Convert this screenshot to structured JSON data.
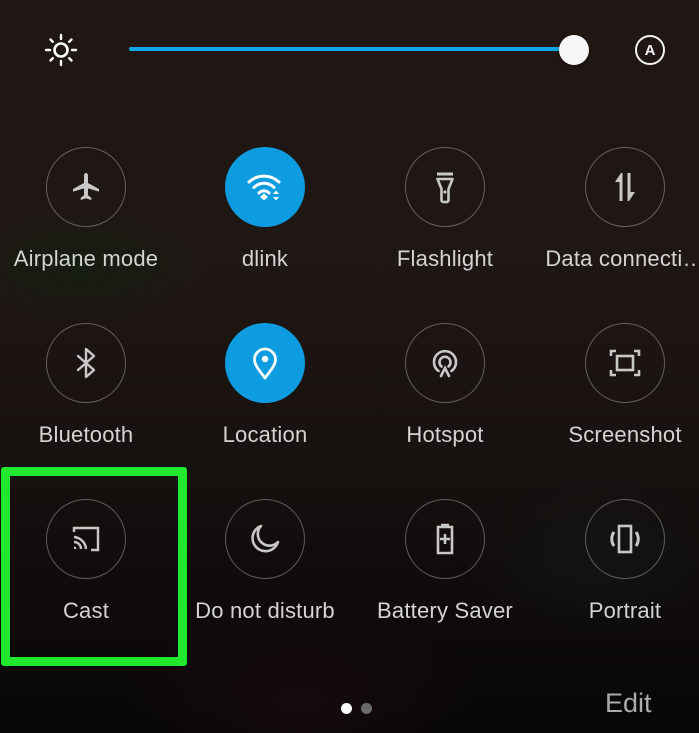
{
  "brightness": {
    "icon": "brightness-sun-icon",
    "level_percent": 100,
    "auto_label": "A",
    "accent_color": "#0ea5e9"
  },
  "tiles": [
    {
      "label": "Airplane mode",
      "icon": "airplane-icon",
      "active": false
    },
    {
      "label": "dlink",
      "icon": "wifi-icon",
      "active": true
    },
    {
      "label": "Flashlight",
      "icon": "flashlight-icon",
      "active": false
    },
    {
      "label": "Data connecti…",
      "icon": "data-connection-icon",
      "active": false
    },
    {
      "label": "Bluetooth",
      "icon": "bluetooth-icon",
      "active": false
    },
    {
      "label": "Location",
      "icon": "location-pin-icon",
      "active": true
    },
    {
      "label": "Hotspot",
      "icon": "hotspot-icon",
      "active": false
    },
    {
      "label": "Screenshot",
      "icon": "screenshot-icon",
      "active": false
    },
    {
      "label": "Cast",
      "icon": "cast-icon",
      "active": false,
      "highlighted": true
    },
    {
      "label": "Do not disturb",
      "icon": "moon-icon",
      "active": false
    },
    {
      "label": "Battery Saver",
      "icon": "battery-saver-icon",
      "active": false
    },
    {
      "label": "Portrait",
      "icon": "rotation-lock-icon",
      "active": false
    }
  ],
  "colors": {
    "active_tile": "#0e9ce0",
    "highlight": "#1fe82f"
  },
  "pager": {
    "pages": 2,
    "current": 1
  },
  "footer": {
    "edit_label": "Edit"
  }
}
